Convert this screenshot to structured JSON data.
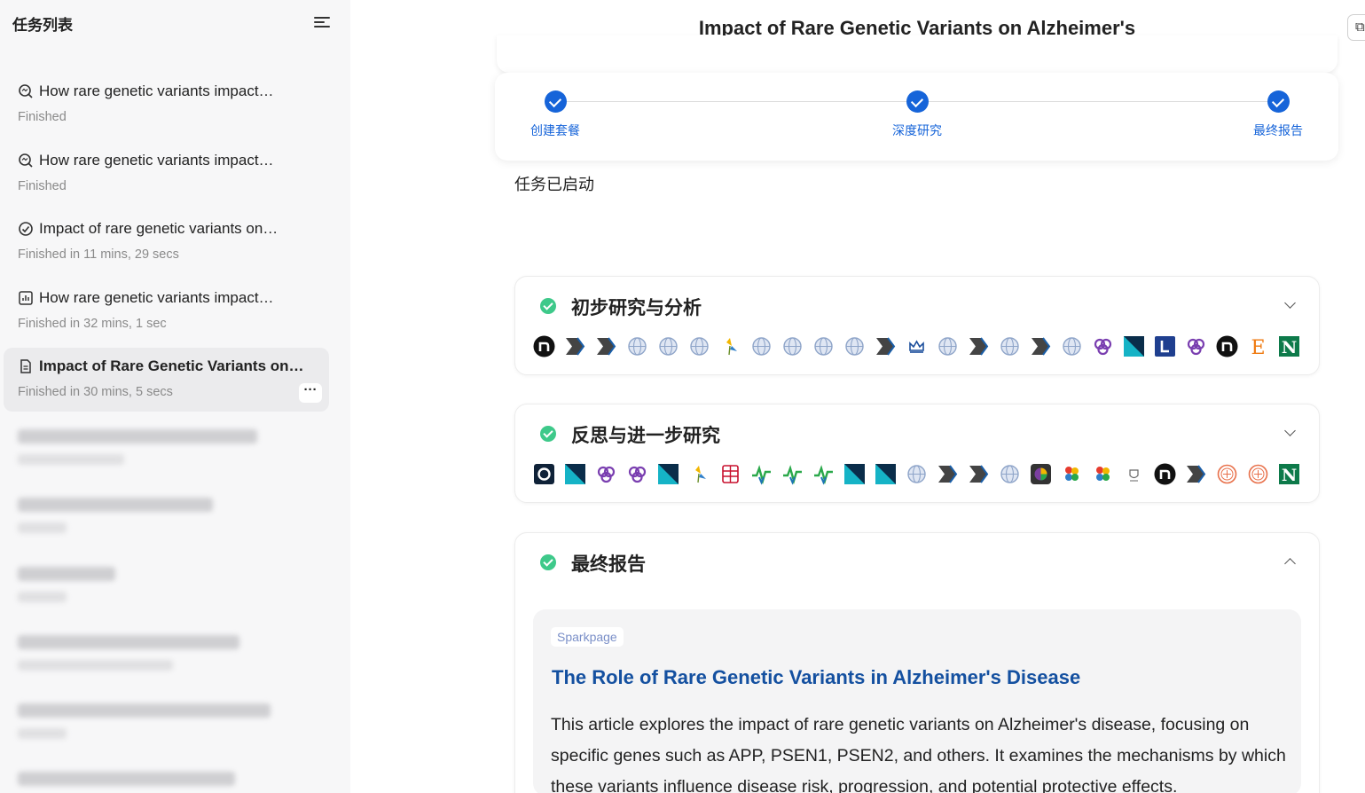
{
  "sidebar": {
    "title": "任务列表",
    "tasks": [
      {
        "title": "How rare genetic variants impact…",
        "status": "Finished",
        "icon": "research-icon"
      },
      {
        "title": "How rare genetic variants impact…",
        "status": "Finished",
        "icon": "research-icon"
      },
      {
        "title": "Impact of rare genetic variants on…",
        "status": "Finished in 11 mins, 29 secs",
        "icon": "check-circle-icon"
      },
      {
        "title": "How rare genetic variants impact…",
        "status": "Finished in 32 mins, 1 sec",
        "icon": "chart-icon"
      },
      {
        "title": "Impact of Rare Genetic Variants on…",
        "status": "Finished in 30 mins, 5 secs",
        "icon": "document-icon",
        "active": true
      }
    ],
    "more_label": "···"
  },
  "header": {
    "title": "Impact of Rare Genetic Variants on Alzheimer's"
  },
  "stepper": {
    "steps": [
      "创建套餐",
      "深度研究",
      "最终报告"
    ]
  },
  "status_text": "任务已启动",
  "sections": [
    {
      "title": "初步研究与分析",
      "sources": [
        "n-circle",
        "arrow-dark",
        "arrow-dark",
        "globe",
        "globe",
        "globe",
        "pinwheel-yellow",
        "globe",
        "globe",
        "globe",
        "globe",
        "arrow-dark",
        "crown",
        "globe",
        "arrow-dark",
        "globe",
        "arrow-dark",
        "globe",
        "linked-rings",
        "teal-diag",
        "L-blue",
        "linked-rings",
        "n-circle",
        "E-orange",
        "N-green"
      ]
    },
    {
      "title": "反思与进一步研究",
      "sources": [
        "ring-dark",
        "teal-diag",
        "linked-rings",
        "linked-rings",
        "teal-diag",
        "pinwheel-yellow",
        "red-shield",
        "green-pulse",
        "green-pulse",
        "green-pulse",
        "teal-diag",
        "teal-diag",
        "globe",
        "arrow-dark",
        "arrow-dark",
        "globe",
        "color-wheel",
        "flower",
        "flower",
        "small-crest",
        "n-circle",
        "arrow-dark",
        "orange-seal",
        "orange-seal",
        "N-green"
      ]
    },
    {
      "title": "最终报告",
      "report": {
        "tag": "Sparkpage",
        "title": "The Role of Rare Genetic Variants in Alzheimer's Disease",
        "body": "This article explores the impact of rare genetic variants on Alzheimer's disease, focusing on specific genes such as APP, PSEN1, PSEN2, and others. It examines the mechanisms by which these variants influence disease risk, progression, and potential protective effects."
      }
    }
  ],
  "colors": {
    "accent": "#1664d9",
    "success": "#3ec98a",
    "report_title": "#1450a0"
  }
}
